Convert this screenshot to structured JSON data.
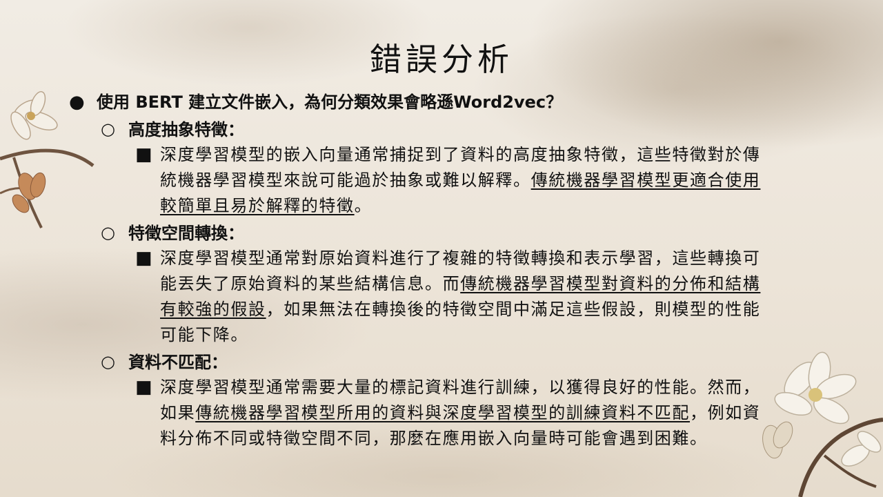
{
  "slide": {
    "title": "錯誤分析",
    "question": {
      "bullet": "●",
      "text": "使用 BERT 建立文件嵌入，為何分類效果會略遜Word2vec？"
    },
    "sections": [
      {
        "marker": "○",
        "heading": "高度抽象特徵：",
        "sub_marker": "■",
        "text_before": "深度學習模型的嵌入向量通常捕捉到了資料的高度抽象特徵，這些特徵對於傳統機器學習模型來說可能過於抽象或難以解釋。",
        "underlined": "傳統機器學習模型更適合使用較簡單且易於解釋的特徵",
        "text_after": "。"
      },
      {
        "marker": "○",
        "heading": "特徵空間轉換：",
        "sub_marker": "■",
        "text_before": "深度學習模型通常對原始資料進行了複雜的特徵轉換和表示學習，這些轉換可能丟失了原始資料的某些結構信息。而",
        "underlined": "傳統機器學習模型對資料的分佈和結構有較強的假設",
        "text_after": "，如果無法在轉換後的特徵空間中滿足這些假設，則模型的性能可能下降。"
      },
      {
        "marker": "○",
        "heading": "資料不匹配：",
        "sub_marker": "■",
        "text_before": "深度學習模型通常需要大量的標記資料進行訓練，以獲得良好的性能。然而，如果",
        "underlined": "傳統機器學習模型所用的資料與深度學習模型的訓練資料不匹配",
        "text_after": "，例如資料分佈不同或特徵空間不同，那麼在應用嵌入向量時可能會遇到困難。"
      }
    ]
  },
  "colors": {
    "text": "#111111",
    "background": "#efe9e0"
  }
}
